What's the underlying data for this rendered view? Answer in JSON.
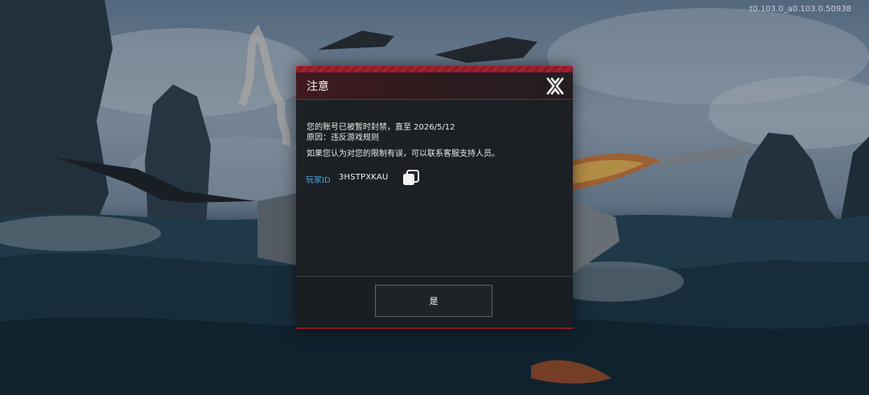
{
  "app": {
    "version": "t0.103.0_a0.103.0.50938"
  },
  "dialog": {
    "title": "注意",
    "message_line1": "您的账号已被暂时封禁，直至 2026/5/12",
    "message_line2": "原因：违反游戏规则",
    "message_line3": "如果您认为对您的限制有误，可以联系客服支持人员。",
    "player_id_label": "玩家ID",
    "player_id_value": "3HSTPXKAU",
    "confirm_label": "是"
  },
  "icons": {
    "close": "close-icon",
    "copy": "copy-icon"
  },
  "colors": {
    "accent_red": "#a3232c",
    "player_id_label": "#4aa7d9",
    "dialog_bg": "#1c2024"
  }
}
